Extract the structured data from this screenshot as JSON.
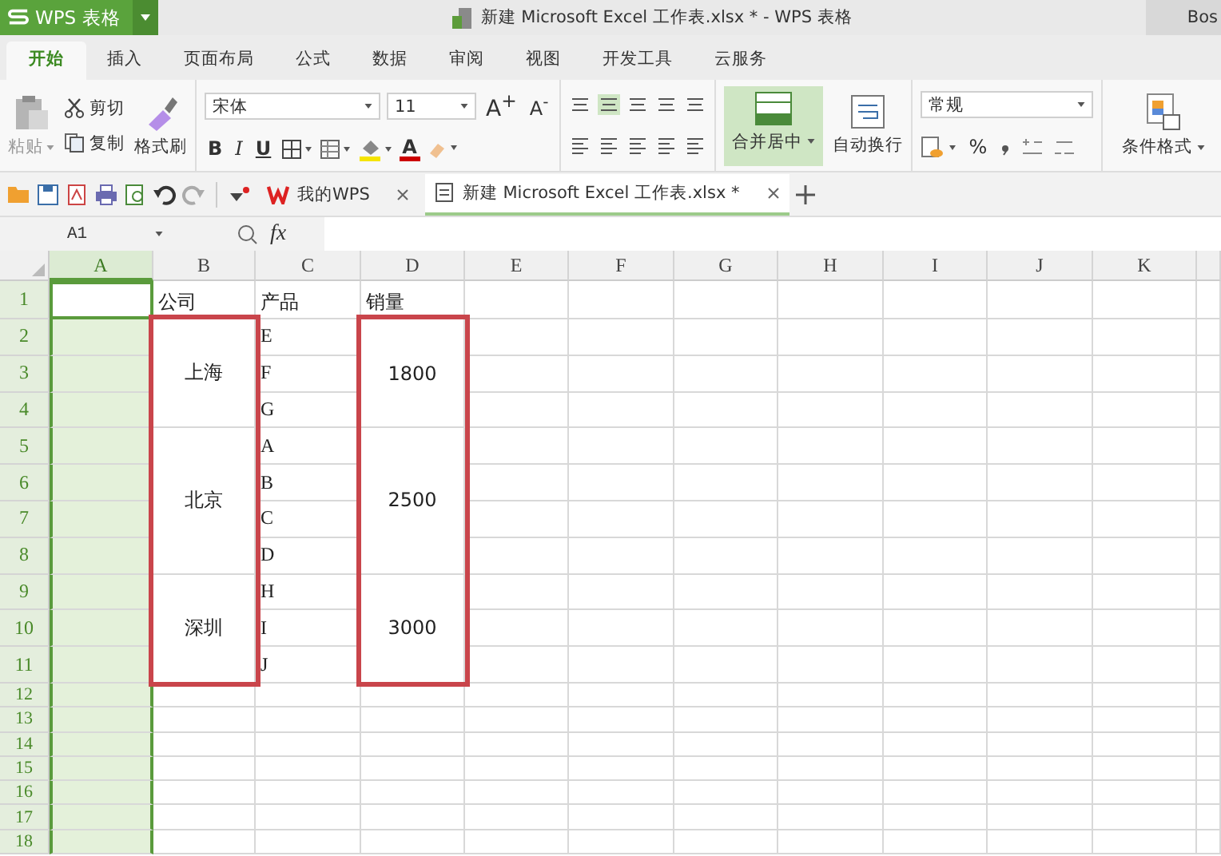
{
  "app": {
    "logo": "WPS 表格",
    "title": "新建 Microsoft Excel 工作表.xlsx * - WPS 表格",
    "user": "Bos"
  },
  "menu_tabs": [
    {
      "label": "开始",
      "selected": true
    },
    {
      "label": "插入",
      "selected": false
    },
    {
      "label": "页面布局",
      "selected": false
    },
    {
      "label": "公式",
      "selected": false
    },
    {
      "label": "数据",
      "selected": false
    },
    {
      "label": "审阅",
      "selected": false
    },
    {
      "label": "视图",
      "selected": false
    },
    {
      "label": "开发工具",
      "selected": false
    },
    {
      "label": "云服务",
      "selected": false
    }
  ],
  "ribbon": {
    "paste": "粘贴",
    "cut": "剪切",
    "copy": "复制",
    "format_painter": "格式刷",
    "font": "宋体",
    "font_size": "11",
    "grow": "A$^{+}$",
    "shrink": "A$^{-}$",
    "bold": "B",
    "italic": "I",
    "underline": "U",
    "font_color": "A",
    "merge_center": "合并居中",
    "wrap_text": "自动换行",
    "number_format": "常规",
    "percent": "%",
    "conditional_format": "条件格式"
  },
  "doc_tabs": [
    {
      "label": "我的WPS",
      "selected": false
    },
    {
      "label": "新建 Microsoft Excel 工作表.xlsx *",
      "selected": true
    }
  ],
  "formula_bar": {
    "name_box": "A1",
    "fx": "fx"
  },
  "sheet": {
    "columns": [
      {
        "label": "A",
        "selected": true
      },
      {
        "label": "B",
        "selected": false
      },
      {
        "label": "C",
        "selected": false
      },
      {
        "label": "D",
        "selected": false
      },
      {
        "label": "E",
        "selected": false
      },
      {
        "label": "F",
        "selected": false
      },
      {
        "label": "G",
        "selected": false
      },
      {
        "label": "H",
        "selected": false
      },
      {
        "label": "I",
        "selected": false
      },
      {
        "label": "J",
        "selected": false
      },
      {
        "label": "K",
        "selected": false
      }
    ],
    "row_labels": [
      "1",
      "2",
      "3",
      "4",
      "5",
      "6",
      "7",
      "8",
      "9",
      "10",
      "11",
      "12",
      "13",
      "14",
      "15",
      "16",
      "17",
      "18"
    ],
    "header": {
      "company": "公司",
      "product": "产品",
      "sales": "销量"
    },
    "groups": [
      {
        "company": "上海",
        "products": [
          "E",
          "F",
          "G"
        ],
        "sales": "1800"
      },
      {
        "company": "北京",
        "products": [
          "A",
          "B",
          "C",
          "D"
        ],
        "sales": "2500"
      },
      {
        "company": "深圳",
        "products": [
          "H",
          "I",
          "J"
        ],
        "sales": "3000"
      }
    ],
    "frames": {
      "company": true,
      "sales": true
    }
  }
}
